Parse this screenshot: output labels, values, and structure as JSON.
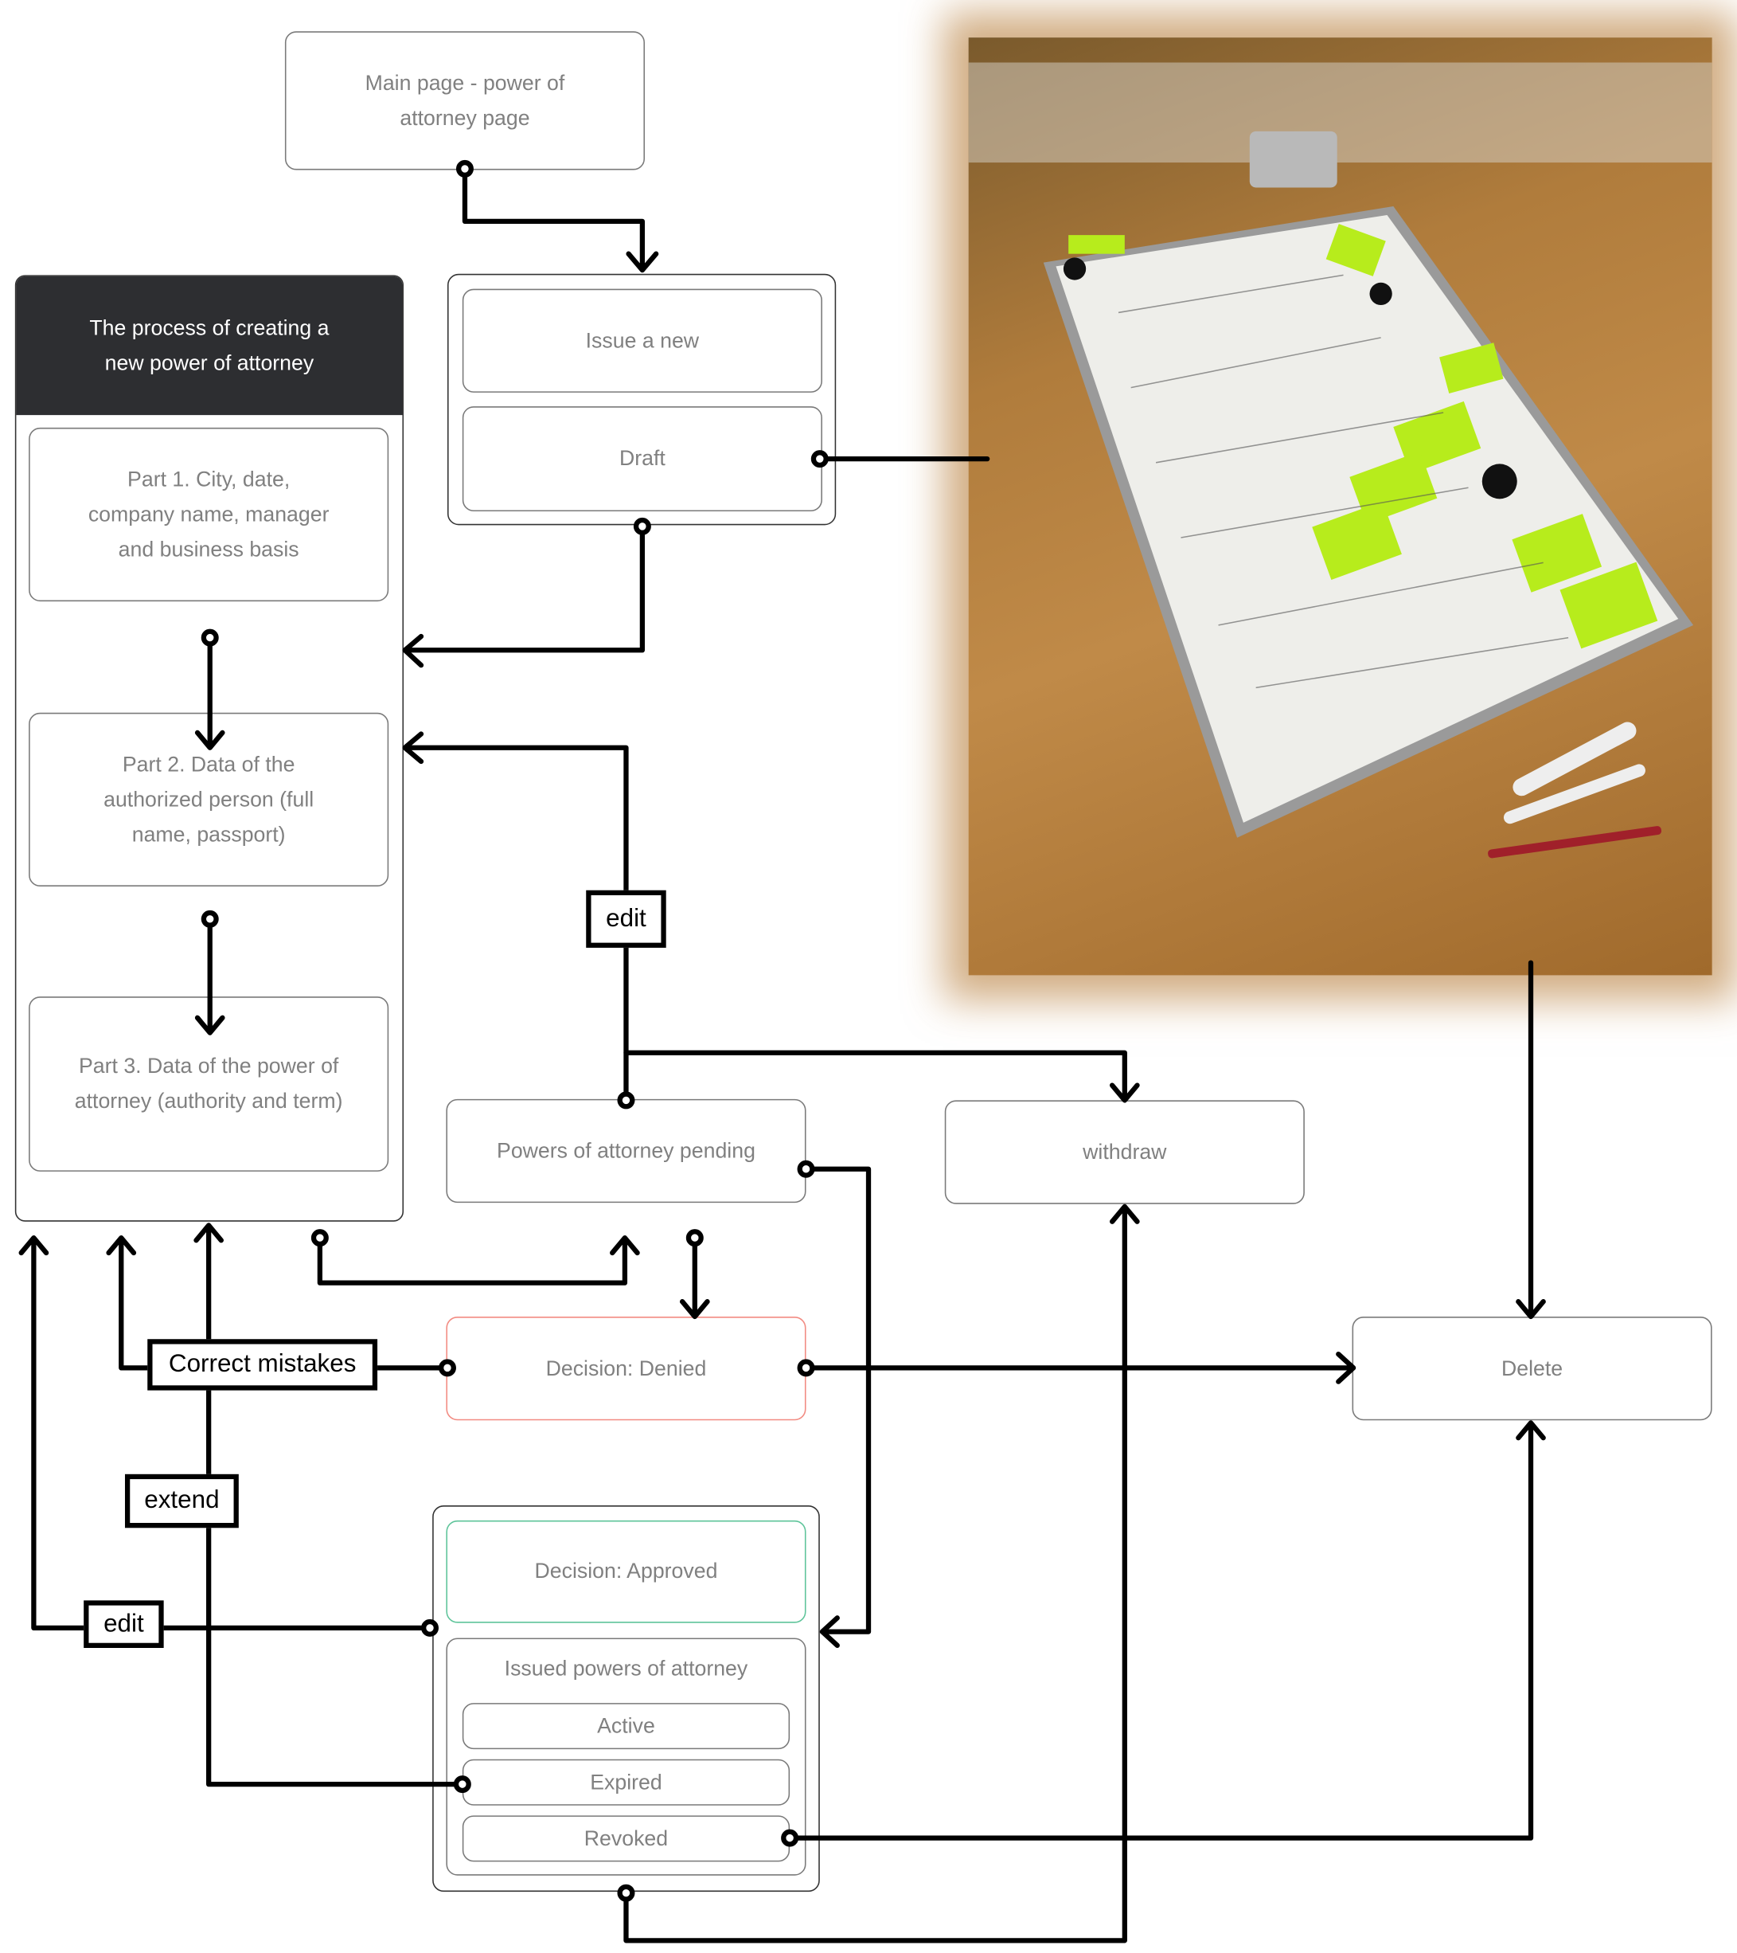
{
  "nodes": {
    "main_page": "Main page - power of attorney page",
    "process_title": "The process of creating a new power of attorney",
    "part1": "Part 1. City, date, company name, manager and business basis",
    "part2": "Part 2. Data of the authorized person (full name, passport)",
    "part3": "Part 3. Data of the power of attorney (authority and term)",
    "issue_new": "Issue a new",
    "draft": "Draft",
    "pending": "Powers of attorney pending",
    "withdraw": "withdraw",
    "denied": "Decision: Denied",
    "delete": "Delete",
    "approved": "Decision: Approved",
    "issued": "Issued powers of attorney",
    "active": "Active",
    "expired": "Expired",
    "revoked": "Revoked"
  },
  "labels": {
    "edit_top": "edit",
    "correct_mistakes": "Correct mistakes",
    "extend": "extend",
    "edit_bottom": "edit"
  },
  "colors": {
    "header_bg": "#2d2e31",
    "denied_border": "#f28b82",
    "approved_border": "#5ec49a"
  }
}
